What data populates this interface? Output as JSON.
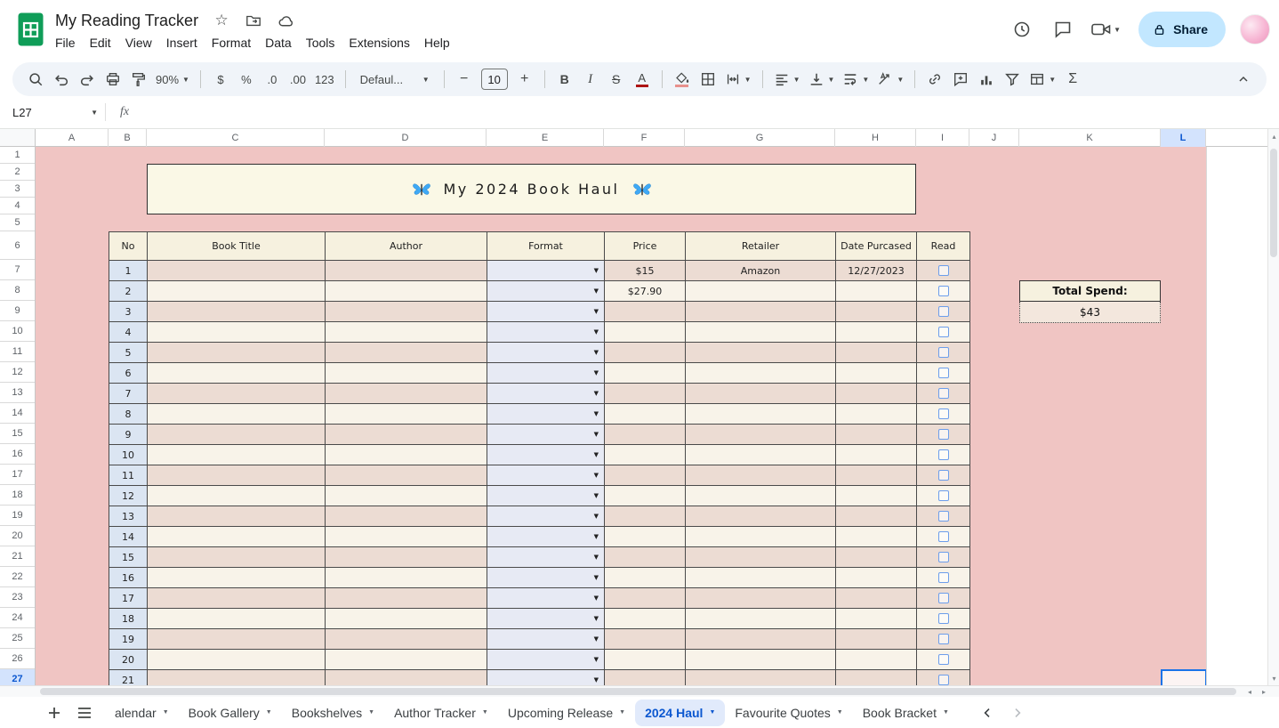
{
  "topbar": {
    "title": "My Reading Tracker",
    "menus": [
      "File",
      "Edit",
      "View",
      "Insert",
      "Format",
      "Data",
      "Tools",
      "Extensions",
      "Help"
    ],
    "share_label": "Share"
  },
  "toolbar": {
    "zoom": "90%",
    "currency": "$",
    "percent": "%",
    "decrease_decimal": ".0",
    "increase_decimal": ".00",
    "number_format": "123",
    "font_name": "Defaul...",
    "minus": "−",
    "font_size": "10",
    "plus": "+",
    "bold": "B",
    "italic": "I",
    "strikethrough": "S",
    "text_color": "A",
    "functions": "Σ"
  },
  "formula_bar": {
    "name_box": "L27",
    "fx_label": "fx"
  },
  "grid": {
    "col_letters": [
      "A",
      "B",
      "C",
      "D",
      "E",
      "F",
      "G",
      "H",
      "I",
      "J",
      "K",
      "L"
    ],
    "row_numbers": [
      1,
      2,
      3,
      4,
      5,
      6,
      7,
      8,
      9,
      10,
      11,
      12,
      13,
      14,
      15,
      16,
      17,
      18,
      19,
      20,
      21,
      22,
      23,
      24,
      25,
      26,
      27
    ],
    "active_col": "L",
    "active_row": 27
  },
  "sheet": {
    "banner_emoji": "🦋",
    "banner_title": "My 2024 Book Haul",
    "table_headers": [
      "No",
      "Book Title",
      "Author",
      "Format",
      "Price",
      "Retailer",
      "Date Purcased",
      "Read"
    ],
    "books": [
      {
        "no": "1",
        "title": "",
        "author": "",
        "format": "",
        "price": "$15",
        "retailer": "Amazon",
        "date": "12/27/2023",
        "read": false
      },
      {
        "no": "2",
        "title": "",
        "author": "",
        "format": "",
        "price": "$27.90",
        "retailer": "",
        "date": "",
        "read": false
      },
      {
        "no": "3",
        "title": "",
        "author": "",
        "format": "",
        "price": "",
        "retailer": "",
        "date": "",
        "read": false
      },
      {
        "no": "4",
        "title": "",
        "author": "",
        "format": "",
        "price": "",
        "retailer": "",
        "date": "",
        "read": false
      },
      {
        "no": "5",
        "title": "",
        "author": "",
        "format": "",
        "price": "",
        "retailer": "",
        "date": "",
        "read": false
      },
      {
        "no": "6",
        "title": "",
        "author": "",
        "format": "",
        "price": "",
        "retailer": "",
        "date": "",
        "read": false
      },
      {
        "no": "7",
        "title": "",
        "author": "",
        "format": "",
        "price": "",
        "retailer": "",
        "date": "",
        "read": false
      },
      {
        "no": "8",
        "title": "",
        "author": "",
        "format": "",
        "price": "",
        "retailer": "",
        "date": "",
        "read": false
      },
      {
        "no": "9",
        "title": "",
        "author": "",
        "format": "",
        "price": "",
        "retailer": "",
        "date": "",
        "read": false
      },
      {
        "no": "10",
        "title": "",
        "author": "",
        "format": "",
        "price": "",
        "retailer": "",
        "date": "",
        "read": false
      },
      {
        "no": "11",
        "title": "",
        "author": "",
        "format": "",
        "price": "",
        "retailer": "",
        "date": "",
        "read": false
      },
      {
        "no": "12",
        "title": "",
        "author": "",
        "format": "",
        "price": "",
        "retailer": "",
        "date": "",
        "read": false
      },
      {
        "no": "13",
        "title": "",
        "author": "",
        "format": "",
        "price": "",
        "retailer": "",
        "date": "",
        "read": false
      },
      {
        "no": "14",
        "title": "",
        "author": "",
        "format": "",
        "price": "",
        "retailer": "",
        "date": "",
        "read": false
      },
      {
        "no": "15",
        "title": "",
        "author": "",
        "format": "",
        "price": "",
        "retailer": "",
        "date": "",
        "read": false
      },
      {
        "no": "16",
        "title": "",
        "author": "",
        "format": "",
        "price": "",
        "retailer": "",
        "date": "",
        "read": false
      },
      {
        "no": "17",
        "title": "",
        "author": "",
        "format": "",
        "price": "",
        "retailer": "",
        "date": "",
        "read": false
      },
      {
        "no": "18",
        "title": "",
        "author": "",
        "format": "",
        "price": "",
        "retailer": "",
        "date": "",
        "read": false
      },
      {
        "no": "19",
        "title": "",
        "author": "",
        "format": "",
        "price": "",
        "retailer": "",
        "date": "",
        "read": false
      },
      {
        "no": "20",
        "title": "",
        "author": "",
        "format": "",
        "price": "",
        "retailer": "",
        "date": "",
        "read": false
      },
      {
        "no": "21",
        "title": "",
        "author": "",
        "format": "",
        "price": "",
        "retailer": "",
        "date": "",
        "read": false
      }
    ],
    "total_spend_label": "Total Spend:",
    "total_spend_value": "$43"
  },
  "sheet_tabs": {
    "tabs": [
      {
        "label": "alendar",
        "active": false
      },
      {
        "label": "Book Gallery",
        "active": false
      },
      {
        "label": "Bookshelves",
        "active": false
      },
      {
        "label": "Author Tracker",
        "active": false
      },
      {
        "label": "Upcoming Release",
        "active": false
      },
      {
        "label": "2024 Haul",
        "active": true
      },
      {
        "label": "Favourite Quotes",
        "active": false
      },
      {
        "label": "Book Bracket",
        "active": false
      }
    ]
  },
  "colors": {
    "canvas_pink": "#f0c5c3",
    "banner_cream": "#faf8e6",
    "row_dark": "#ecdcd3",
    "row_light": "#f8f3e9",
    "accent_blue": "#0b57d0",
    "share_bg": "#c2e7ff",
    "selection_blue": "#1a73e8"
  }
}
